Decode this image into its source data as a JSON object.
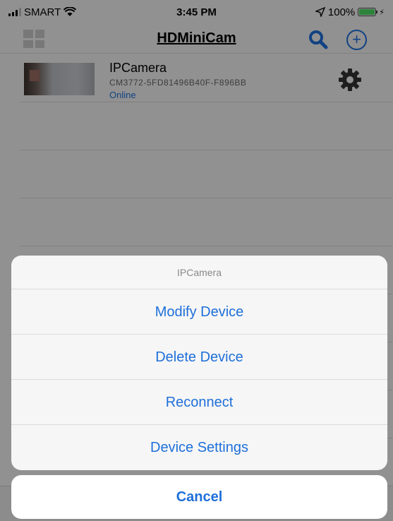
{
  "status_bar": {
    "carrier": "SMART",
    "time": "3:45 PM",
    "battery": "100%"
  },
  "nav": {
    "title": "HDMiniCam",
    "icons": [
      "grid-icon",
      "search-icon",
      "add-icon"
    ]
  },
  "devices": [
    {
      "name": "IPCamera",
      "id": "CM3772-5FD81496B40F-F896BB",
      "status": "Online"
    }
  ],
  "action_sheet": {
    "title": "IPCamera",
    "options": [
      "Modify Device",
      "Delete Device",
      "Reconnect",
      "Device Settings"
    ],
    "cancel": "Cancel"
  },
  "colors": {
    "accent": "#1e6fd9",
    "battery": "#4cd964"
  }
}
